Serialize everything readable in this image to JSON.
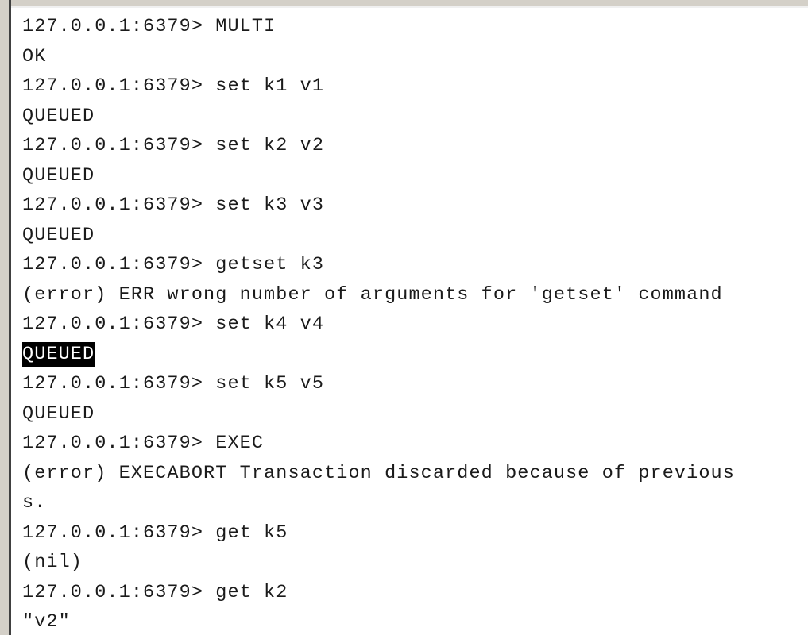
{
  "terminal": {
    "lines": [
      "127.0.0.1:6379> MULTI",
      "OK",
      "127.0.0.1:6379> set k1 v1",
      "QUEUED",
      "127.0.0.1:6379> set k2 v2",
      "QUEUED",
      "127.0.0.1:6379> set k3 v3",
      "QUEUED",
      "127.0.0.1:6379> getset k3",
      "(error) ERR wrong number of arguments for 'getset' command",
      "127.0.0.1:6379> set k4 v4",
      "QUEUED",
      "127.0.0.1:6379> set k5 v5",
      "QUEUED",
      "127.0.0.1:6379> EXEC",
      "(error) EXECABORT Transaction discarded because of previous",
      "s.",
      "127.0.0.1:6379> get k5",
      "(nil)",
      "127.0.0.1:6379> get k2",
      "\"v2\""
    ],
    "selected_text": "QUEUED"
  }
}
